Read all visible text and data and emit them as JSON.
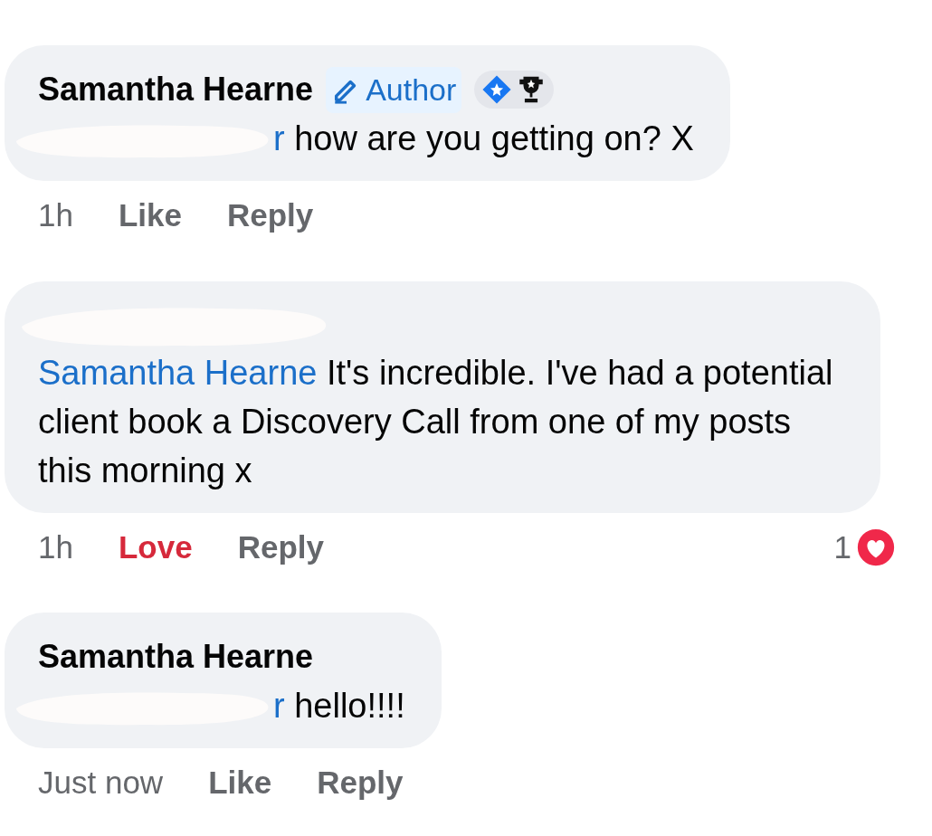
{
  "comments": [
    {
      "author": {
        "name": "Samantha Hearne",
        "redacted": false
      },
      "author_badge": "Author",
      "achievement_icons": true,
      "mention": {
        "text": "r",
        "redacted": true
      },
      "text": "how are you getting on? X",
      "time": "1h",
      "reaction": {
        "label": "Like",
        "kind": "like"
      },
      "reply": "Reply"
    },
    {
      "author": {
        "redacted": true
      },
      "achievement_icons": false,
      "mention": {
        "text": "Samantha Hearne",
        "redacted": false
      },
      "text": "It's incredible. I've had a potential client book a Discovery Call from one of my posts this morning x",
      "time": "1h",
      "reaction": {
        "label": "Love",
        "kind": "love"
      },
      "reply": "Reply",
      "reaction_count": "1"
    },
    {
      "author": {
        "name": "Samantha Hearne",
        "redacted": false
      },
      "achievement_icons": false,
      "mention": {
        "text": "r",
        "redacted": true
      },
      "text": "hello!!!!",
      "time": "Just now",
      "reaction": {
        "label": "Like",
        "kind": "like"
      },
      "reply": "Reply"
    }
  ]
}
